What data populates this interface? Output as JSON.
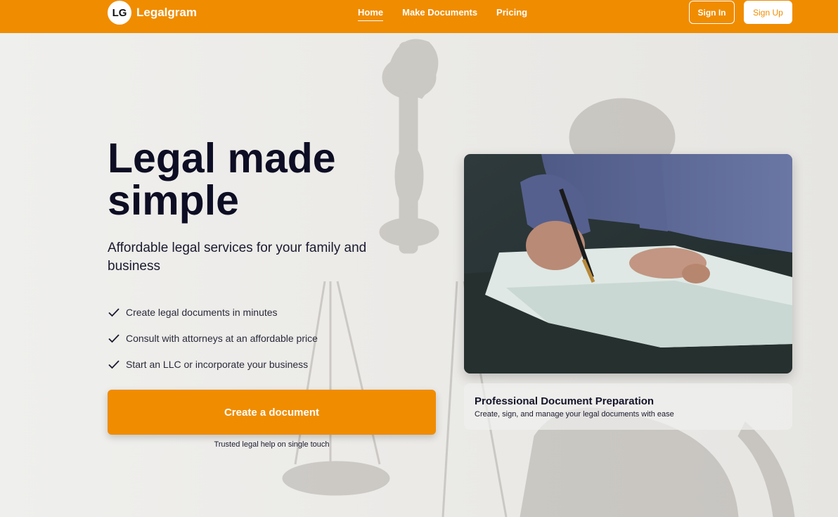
{
  "header": {
    "logo_badge": "LG",
    "brand": "Legalgram",
    "nav": [
      {
        "label": "Home",
        "active": true
      },
      {
        "label": "Make Documents",
        "active": false
      },
      {
        "label": "Pricing",
        "active": false
      }
    ],
    "sign_in": "Sign In",
    "sign_up": "Sign Up",
    "accent_color": "#f08c00"
  },
  "hero": {
    "title": "Legal made simple",
    "subtitle": "Affordable legal services for your family and business",
    "features": [
      "Create legal documents in minutes",
      "Consult with attorneys at an affordable price",
      "Start an LLC or incorporate your business"
    ],
    "cta_label": "Create a document",
    "cta_note": "Trusted legal help on single touch"
  },
  "card": {
    "image_alt": "Person signing document",
    "title": "Professional Document Preparation",
    "text": "Create, sign, and manage your legal documents with ease"
  }
}
